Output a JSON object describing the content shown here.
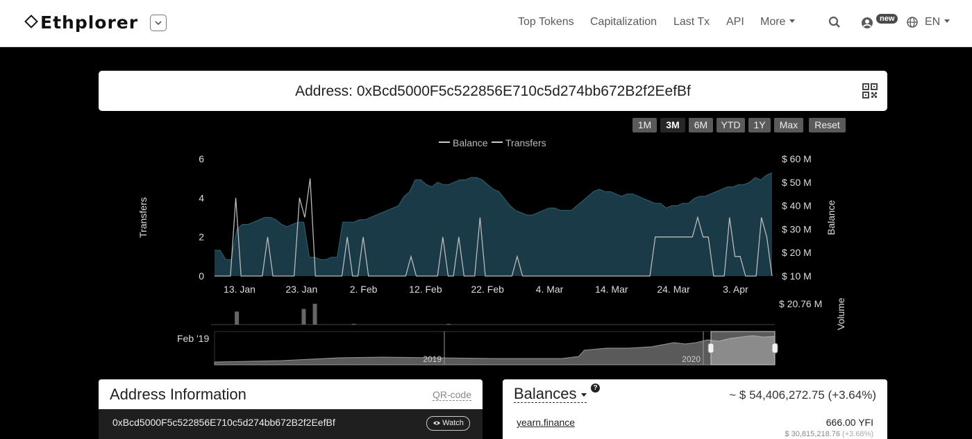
{
  "nav": {
    "brand": "Ethplorer",
    "items": [
      {
        "label": "Top Tokens"
      },
      {
        "label": "Capitalization"
      },
      {
        "label": "Last Tx"
      },
      {
        "label": "API"
      },
      {
        "label": "More"
      }
    ],
    "new_badge": "new",
    "lang": "EN",
    "icons": [
      "search-icon",
      "user-icon",
      "globe-icon",
      "chevron-down-icon"
    ]
  },
  "address": {
    "title": "Address: 0xBcd5000F5c522856E710c5d274bb672B2f2EefBf"
  },
  "chart_controls": {
    "ranges": [
      "1M",
      "3M",
      "6M",
      "YTD",
      "1Y",
      "Max"
    ],
    "selected": "3M",
    "reset": "Reset"
  },
  "chart_data": {
    "type": "area",
    "series": [
      {
        "name": "Balance",
        "color": "#1b3a47",
        "values": [
          21,
          21,
          17,
          17,
          30,
          32,
          32,
          33,
          34,
          35,
          35,
          34,
          32,
          31,
          32,
          33,
          33,
          18,
          18,
          17,
          17,
          18,
          18,
          33,
          33,
          33,
          34,
          34,
          35,
          36,
          37,
          38,
          39,
          40,
          44,
          46,
          51,
          51,
          49,
          48,
          50,
          49,
          49,
          50,
          51,
          51,
          52,
          52,
          51,
          49,
          47,
          46,
          43,
          40,
          38,
          37,
          36,
          36,
          37,
          38,
          39,
          39,
          38,
          38,
          38,
          40,
          42,
          44,
          46,
          47,
          46,
          46,
          45,
          44,
          45,
          45,
          44,
          43,
          42,
          41,
          41,
          39,
          40,
          40,
          41,
          41,
          43,
          44,
          44,
          45,
          46,
          47,
          48,
          48,
          49,
          49,
          50,
          52,
          51,
          53,
          54
        ]
      },
      {
        "name": "Transfers",
        "color": "#bbbbbb",
        "values": [
          0,
          0,
          0,
          0,
          4,
          0,
          0,
          0,
          0,
          0,
          2,
          0,
          0,
          0,
          0,
          0,
          4,
          3,
          5,
          0,
          0,
          0,
          0,
          0,
          0,
          2,
          0,
          0,
          2,
          0,
          0,
          0,
          0,
          0,
          0,
          0,
          0,
          1,
          0,
          0,
          0,
          0,
          0,
          2,
          0,
          0,
          2,
          0,
          0,
          0,
          3,
          0,
          0,
          0,
          0,
          0,
          0,
          1,
          0,
          0,
          0,
          0,
          0,
          0,
          0,
          0,
          0,
          0,
          0,
          0,
          0,
          0,
          0,
          0,
          0,
          0,
          0,
          0,
          0,
          0,
          0,
          0,
          0,
          2,
          2,
          2,
          2,
          2,
          2,
          2,
          2,
          3,
          2,
          2,
          0,
          0,
          0,
          3,
          1,
          1,
          0,
          0,
          0,
          3,
          2,
          0
        ]
      }
    ],
    "x_ticks": [
      "13. Jan",
      "23. Jan",
      "2. Feb",
      "12. Feb",
      "22. Feb",
      "4. Mar",
      "14. Mar",
      "24. Mar",
      "3. Apr"
    ],
    "left_axis": {
      "title": "Transfers",
      "ticks": [
        "0",
        "2",
        "4",
        "6"
      ],
      "range": [
        0,
        6
      ]
    },
    "right_axis": {
      "title": "Balance",
      "ticks": [
        "$ 10 M",
        "$ 20 M",
        "$ 30 M",
        "$ 40 M",
        "$ 50 M",
        "$ 60 M"
      ],
      "range": [
        10,
        60
      ]
    },
    "volume": {
      "title": "Volume",
      "max_label": "$ 20.76 M",
      "bars": [
        0,
        0,
        0,
        0,
        5,
        0,
        0,
        0,
        0,
        0,
        0,
        0,
        0,
        0,
        0,
        0,
        6,
        0,
        8,
        0,
        0,
        0,
        0,
        0,
        0,
        0.3,
        0,
        0,
        0,
        0,
        0,
        0,
        0,
        0,
        0,
        0,
        0,
        0,
        0,
        0,
        0,
        0,
        0.2,
        0,
        0,
        0,
        0,
        0,
        0,
        0,
        0,
        0,
        0,
        0,
        0,
        0,
        0,
        0,
        0,
        0,
        0,
        0,
        0,
        0,
        0,
        0,
        0,
        0,
        0,
        0,
        0,
        0,
        0,
        0,
        0,
        0,
        0,
        0,
        0,
        0,
        0,
        0,
        0,
        0,
        0,
        0,
        0,
        0,
        0,
        0,
        0,
        0,
        0,
        0,
        0,
        0,
        0,
        0,
        0,
        0
      ]
    },
    "navigator": {
      "label": "Feb '19",
      "years": [
        "2019",
        "2020"
      ]
    },
    "legend": "top-center"
  },
  "address_info": {
    "title": "Address Information",
    "qr_link": "QR-code",
    "address": "0xBcd5000F5c522856E710c5d274bb672B2f2EefBf",
    "watch": "Watch"
  },
  "balances": {
    "title": "Balances",
    "total": "~ $ 54,406,272.75 (+3.64%)",
    "rows": [
      {
        "token": "yearn.finance",
        "amount": "666.00 YFI",
        "usd": "$ 30,815,218.76",
        "change": "(+3.68%)"
      }
    ]
  }
}
